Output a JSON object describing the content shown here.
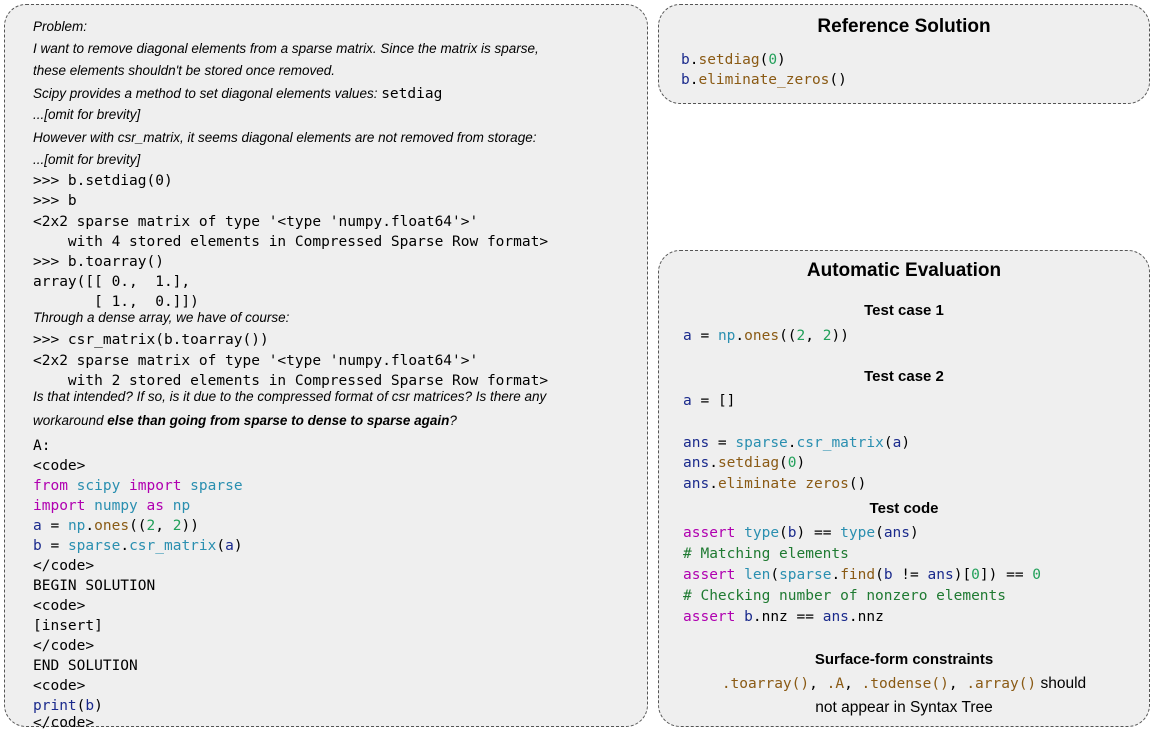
{
  "problem": {
    "lines": [
      "Problem:",
      "I want to remove diagonal elements from a sparse matrix. Since the matrix is sparse,",
      "these elements shouldn't be stored once removed.",
      "Scipy provides a method to set diagonal elements values: ",
      "setdiag",
      "...[omit for brevity]",
      "However with csr_matrix, it seems diagonal elements are not removed from storage:",
      "...[omit for brevity]",
      ">>> b.setdiag(0)",
      ">>> b",
      "<2x2 sparse matrix of type '<type 'numpy.float64'>'",
      "    with 4 stored elements in Compressed Sparse Row format>",
      ">>> b.toarray()",
      "array([[ 0.,  1.],",
      "       [ 1.,  0.]])",
      "Through a dense array, we have of course:",
      ">>> csr_matrix(b.toarray())",
      "<2x2 sparse matrix of type '<type 'numpy.float64'>'",
      "    with 2 stored elements in Compressed Sparse Row format>",
      "Is that intended? If so, is it due to the compressed format of csr matrices? Is there any",
      "workaround ",
      "else than going from sparse to dense to sparse again",
      "?"
    ],
    "code": {
      "a_label": "A:",
      "code_open": "<code>",
      "from": "from",
      "scipy": "scipy",
      "import": "import",
      "sparse": "sparse",
      "numpy": "numpy",
      "as": "as",
      "np": "np",
      "a": "a",
      "eq": " = ",
      "dot": ".",
      "ones": "ones",
      "lp": "((",
      "n2": "2",
      "comma": ", ",
      "rp": "))",
      "b": "b",
      "csr_matrix": "csr_matrix",
      "open_paren": "(",
      "close_paren": ")",
      "code_close": "</code>",
      "begin": "BEGIN SOLUTION",
      "insert": "[insert]",
      "end": "END SOLUTION",
      "print": "print"
    }
  },
  "reference": {
    "title": "Reference Solution",
    "b": "b",
    "dot": ".",
    "setdiag": "setdiag",
    "open": "(",
    "zero": "0",
    "close": ")",
    "eliminate_zeros": "eliminate_zeros",
    "empty_parens": "()"
  },
  "evaluation": {
    "title": "Automatic Evaluation",
    "test_case_1": "Test case 1",
    "test_case_2": "Test case 2",
    "test_code": "Test code",
    "constraints_title": "Surface-form constraints",
    "constraints_text_1": " should",
    "constraints_text_2": "not appear in Syntax Tree",
    "toks": {
      "a": "a",
      "eq": " = ",
      "np": "np",
      "dot": ".",
      "ones": "ones",
      "lp": "((",
      "n2": "2",
      "comma": ", ",
      "rp": "))",
      "empty_list": "[]",
      "ans": "ans",
      "sparse": "sparse",
      "csr_matrix": "csr_matrix",
      "open": "(",
      "close": ")",
      "setdiag": "setdiag",
      "zero": "0",
      "eliminate": "eliminate zeros",
      "empty_parens": "()",
      "assert": "assert",
      "type": "type",
      "b": "b",
      "deq": " == ",
      "cm1": "# Matching elements",
      "len": "len",
      "find": "find",
      "neq": " != ",
      "idx0_open": "[",
      "idx0_close": "])",
      "close2": ")",
      "cm2": "# Checking number of nonzero elements",
      "nnz": "nnz",
      "c_toarray": ".toarray()",
      "c_A": ".A",
      "c_todense": ".todense()",
      "c_array": ".array()",
      "sep": ", "
    }
  }
}
